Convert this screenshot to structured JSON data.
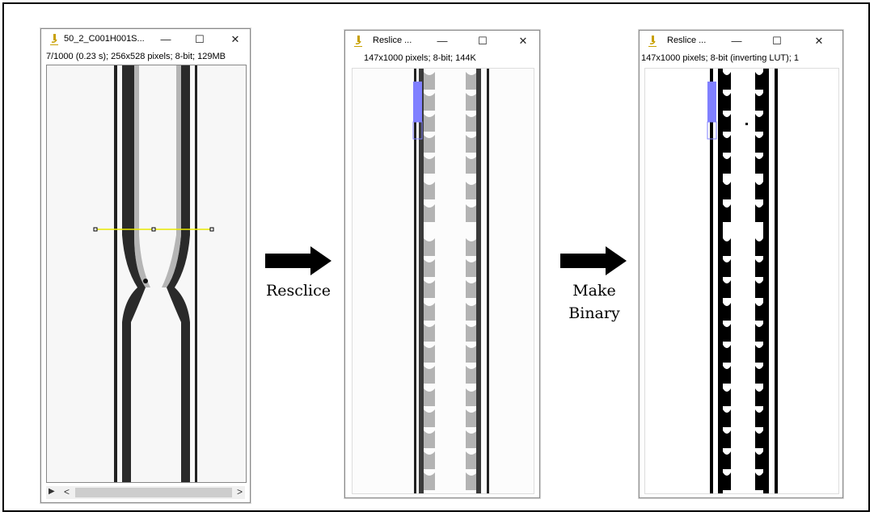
{
  "window1": {
    "title": "50_2_C001H001S...",
    "info": "7/1000 (0.23 s); 256x528 pixels; 8-bit; 129MB",
    "minimize": "—",
    "maximize": "☐",
    "close": "✕",
    "play": "▶",
    "scroll_left": "<",
    "scroll_right": ">"
  },
  "window2": {
    "title": "Reslice ...",
    "info": "147x1000 pixels; 8-bit; 144K",
    "minimize": "—",
    "maximize": "☐",
    "close": "✕"
  },
  "window3": {
    "title": "Reslice ...",
    "info": "147x1000 pixels; 8-bit (inverting LUT); 1",
    "minimize": "—",
    "maximize": "☐",
    "close": "✕"
  },
  "steps": {
    "step1": "Resclice",
    "step2_line1": "Make",
    "step2_line2": "Binary"
  },
  "colors": {
    "selection_line": "#e8e800",
    "slider": "#8080ff",
    "app_icon": "#c8a000"
  }
}
